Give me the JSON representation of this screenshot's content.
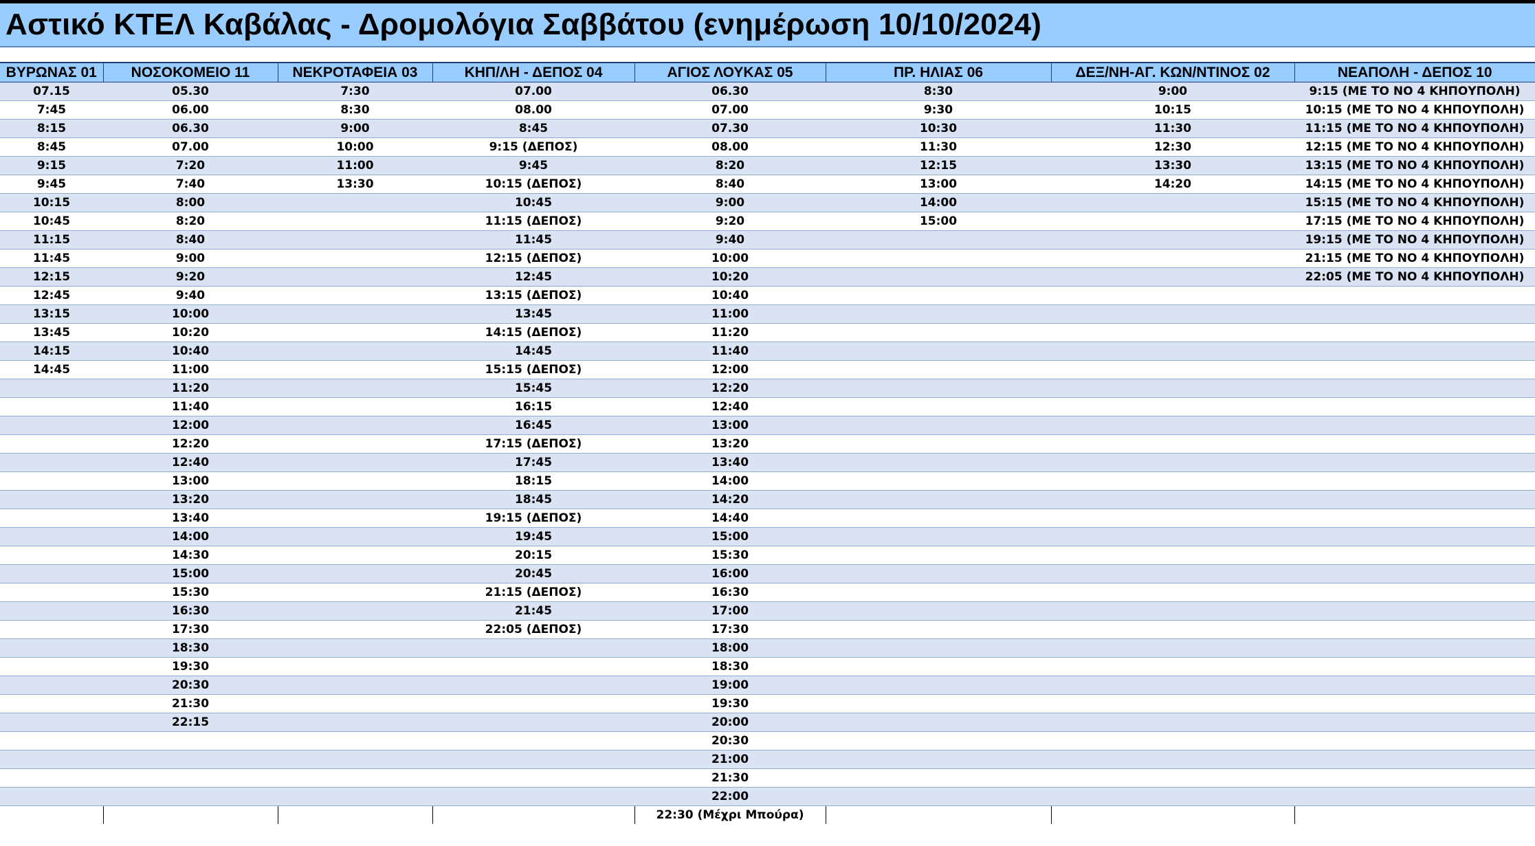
{
  "title": "Αστικό ΚΤΕΛ Καβάλας - Δρομολόγια Σαββάτου (ενημέρωση 10/10/2024)",
  "columns": [
    "ΒΥΡΩΝΑΣ 01",
    "ΝΟΣΟΚΟΜΕΙΟ 11",
    "ΝΕΚΡΟΤΑΦΕΙΑ 03",
    "ΚΗΠ/ΛΗ - ΔΕΠΟΣ 04",
    "ΑΓΙΟΣ ΛΟΥΚΑΣ 05",
    "ΠΡ. ΗΛΙΑΣ 06",
    "ΔΕΞ/ΝΗ-ΑΓ. ΚΩΝ/ΝΤΙΝΟΣ 02",
    "ΝΕΑΠΟΛΗ - ΔΕΠΟΣ 10"
  ],
  "rows": [
    [
      "07.15",
      "05.30",
      "7:30",
      "07.00",
      "06.30",
      "8:30",
      "9:00",
      "9:15 (ΜΕ ΤΟ ΝΟ 4 ΚΗΠΟΥΠΟΛΗ)"
    ],
    [
      "7:45",
      "06.00",
      "8:30",
      "08.00",
      "07.00",
      "9:30",
      "10:15",
      "10:15 (ΜΕ ΤΟ ΝΟ 4 ΚΗΠΟΥΠΟΛΗ)"
    ],
    [
      "8:15",
      "06.30",
      "9:00",
      "8:45",
      "07.30",
      "10:30",
      "11:30",
      "11:15 (ΜΕ ΤΟ ΝΟ 4 ΚΗΠΟΥΠΟΛΗ)"
    ],
    [
      "8:45",
      "07.00",
      "10:00",
      "9:15 (ΔΕΠΟΣ)",
      "08.00",
      "11:30",
      "12:30",
      "12:15 (ΜΕ ΤΟ ΝΟ 4 ΚΗΠΟΥΠΟΛΗ)"
    ],
    [
      "9:15",
      "7:20",
      "11:00",
      "9:45",
      "8:20",
      "12:15",
      "13:30",
      "13:15 (ΜΕ ΤΟ ΝΟ 4 ΚΗΠΟΥΠΟΛΗ)"
    ],
    [
      "9:45",
      "7:40",
      "13:30",
      "10:15 (ΔΕΠΟΣ)",
      "8:40",
      "13:00",
      "14:20",
      "14:15 (ΜΕ ΤΟ ΝΟ 4 ΚΗΠΟΥΠΟΛΗ)"
    ],
    [
      "10:15",
      "8:00",
      "",
      "10:45",
      "9:00",
      "14:00",
      "",
      "15:15 (ΜΕ ΤΟ ΝΟ 4 ΚΗΠΟΥΠΟΛΗ)"
    ],
    [
      "10:45",
      "8:20",
      "",
      "11:15 (ΔΕΠΟΣ)",
      "9:20",
      "15:00",
      "",
      "17:15 (ΜΕ ΤΟ ΝΟ 4 ΚΗΠΟΥΠΟΛΗ)"
    ],
    [
      "11:15",
      "8:40",
      "",
      "11:45",
      "9:40",
      "",
      "",
      "19:15 (ΜΕ ΤΟ ΝΟ 4 ΚΗΠΟΥΠΟΛΗ)"
    ],
    [
      "11:45",
      "9:00",
      "",
      "12:15 (ΔΕΠΟΣ)",
      "10:00",
      "",
      "",
      "21:15 (ΜΕ ΤΟ ΝΟ 4 ΚΗΠΟΥΠΟΛΗ)"
    ],
    [
      "12:15",
      "9:20",
      "",
      "12:45",
      "10:20",
      "",
      "",
      "22:05 (ΜΕ ΤΟ ΝΟ 4 ΚΗΠΟΥΠΟΛΗ)"
    ],
    [
      "12:45",
      "9:40",
      "",
      "13:15 (ΔΕΠΟΣ)",
      "10:40",
      "",
      "",
      ""
    ],
    [
      "13:15",
      "10:00",
      "",
      "13:45",
      "11:00",
      "",
      "",
      ""
    ],
    [
      "13:45",
      "10:20",
      "",
      "14:15 (ΔΕΠΟΣ)",
      "11:20",
      "",
      "",
      ""
    ],
    [
      "14:15",
      "10:40",
      "",
      "14:45",
      "11:40",
      "",
      "",
      ""
    ],
    [
      "14:45",
      "11:00",
      "",
      "15:15 (ΔΕΠΟΣ)",
      "12:00",
      "",
      "",
      ""
    ],
    [
      "",
      "11:20",
      "",
      "15:45",
      "12:20",
      "",
      "",
      ""
    ],
    [
      "",
      "11:40",
      "",
      "16:15",
      "12:40",
      "",
      "",
      ""
    ],
    [
      "",
      "12:00",
      "",
      "16:45",
      "13:00",
      "",
      "",
      ""
    ],
    [
      "",
      "12:20",
      "",
      "17:15 (ΔΕΠΟΣ)",
      "13:20",
      "",
      "",
      ""
    ],
    [
      "",
      "12:40",
      "",
      "17:45",
      "13:40",
      "",
      "",
      ""
    ],
    [
      "",
      "13:00",
      "",
      "18:15",
      "14:00",
      "",
      "",
      ""
    ],
    [
      "",
      "13:20",
      "",
      "18:45",
      "14:20",
      "",
      "",
      ""
    ],
    [
      "",
      "13:40",
      "",
      "19:15 (ΔΕΠΟΣ)",
      "14:40",
      "",
      "",
      ""
    ],
    [
      "",
      "14:00",
      "",
      "19:45",
      "15:00",
      "",
      "",
      ""
    ],
    [
      "",
      "14:30",
      "",
      "20:15",
      "15:30",
      "",
      "",
      ""
    ],
    [
      "",
      "15:00",
      "",
      "20:45",
      "16:00",
      "",
      "",
      ""
    ],
    [
      "",
      "15:30",
      "",
      "21:15 (ΔΕΠΟΣ)",
      "16:30",
      "",
      "",
      ""
    ],
    [
      "",
      "16:30",
      "",
      "21:45",
      "17:00",
      "",
      "",
      ""
    ],
    [
      "",
      "17:30",
      "",
      "22:05 (ΔΕΠΟΣ)",
      "17:30",
      "",
      "",
      ""
    ],
    [
      "",
      "18:30",
      "",
      "",
      "18:00",
      "",
      "",
      ""
    ],
    [
      "",
      "19:30",
      "",
      "",
      "18:30",
      "",
      "",
      ""
    ],
    [
      "",
      "20:30",
      "",
      "",
      "19:00",
      "",
      "",
      ""
    ],
    [
      "",
      "21:30",
      "",
      "",
      "19:30",
      "",
      "",
      ""
    ],
    [
      "",
      "22:15",
      "",
      "",
      "20:00",
      "",
      "",
      ""
    ],
    [
      "",
      "",
      "",
      "",
      "20:30",
      "",
      "",
      ""
    ],
    [
      "",
      "",
      "",
      "",
      "21:00",
      "",
      "",
      ""
    ],
    [
      "",
      "",
      "",
      "",
      "21:30",
      "",
      "",
      ""
    ],
    [
      "",
      "",
      "",
      "",
      "22:00",
      "",
      "",
      ""
    ],
    [
      "",
      "",
      "",
      "",
      "22:30 (Μέχρι Μπούρα)",
      "",
      "",
      ""
    ]
  ]
}
